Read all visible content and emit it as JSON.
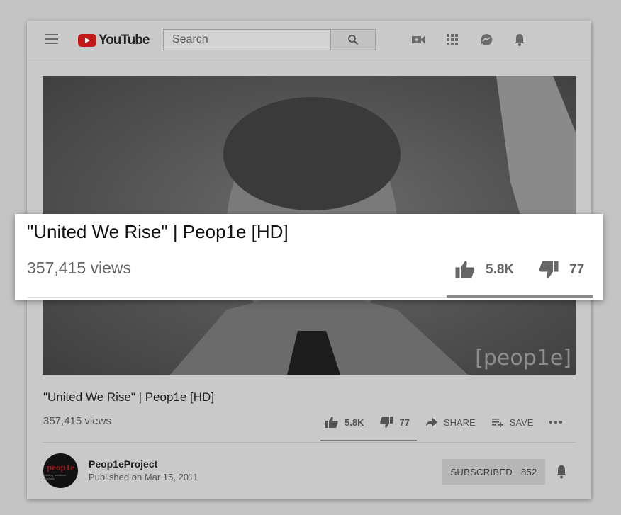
{
  "header": {
    "logo_text": "YouTube",
    "search_placeholder": "Search",
    "icons": [
      "menu-icon",
      "search-icon",
      "video-camera-add-icon",
      "apps-grid-icon",
      "messages-icon",
      "notifications-bell-icon"
    ]
  },
  "video": {
    "watermark": "[peop1e]"
  },
  "highlight": {
    "title": "\"United We Rise\" | Peop1e [HD]",
    "views": "357,415 views",
    "likes": "5.8K",
    "dislikes": "77"
  },
  "details": {
    "title": "\"United We Rise\" | Peop1e [HD]",
    "views": "357,415 views",
    "likes": "5.8K",
    "dislikes": "77",
    "share_label": "SHARE",
    "save_label": "SAVE"
  },
  "channel": {
    "name": "Peop1eProject",
    "published": "Published on Mar 15, 2011",
    "avatar_text": "peop1e",
    "avatar_subtext": "building, solutions, mindfully",
    "subscribe_label": "SUBSCRIBED",
    "subscriber_count": "852"
  },
  "colors": {
    "youtube_red": "#c21a1a",
    "dim_background": "#c4c4c4",
    "highlight_background": "#ffffff"
  }
}
